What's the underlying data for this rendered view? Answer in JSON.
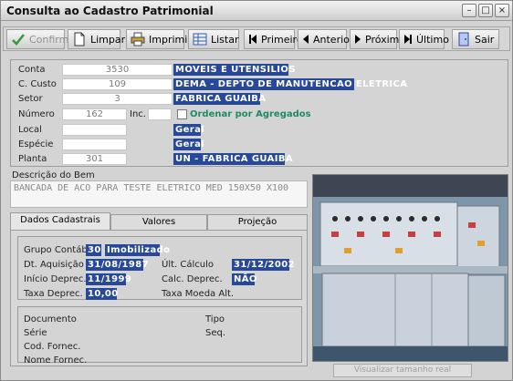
{
  "window": {
    "title": "Consulta ao Cadastro Patrimonial"
  },
  "toolbar": {
    "confirmar": "Confirmar",
    "limpar": "Limpar",
    "imprimir": "Imprimir",
    "listar": "Listar",
    "primeiro": "Primeiro",
    "anterior": "Anterior",
    "proximo": "Próximo",
    "ultimo": "Último",
    "sair": "Sair"
  },
  "form": {
    "conta": {
      "label": "Conta",
      "code": "3530",
      "desc": "MOVEIS E UTENSILIOS"
    },
    "custo": {
      "label": "C. Custo",
      "code": "109",
      "desc": "DEMA - DEPTO DE MANUTENCAO ELETRICA"
    },
    "setor": {
      "label": "Setor",
      "code": "3",
      "desc": "FABRICA GUAIBA"
    },
    "numero": {
      "label": "Número",
      "code": "162",
      "inc_label": "Inc.",
      "inc_value": ""
    },
    "ordenar": {
      "label": "Ordenar por Agregados",
      "checked": false
    },
    "local": {
      "label": "Local",
      "code": "",
      "desc": "Geral"
    },
    "especie": {
      "label": "Espécie",
      "code": "",
      "desc": "Geral"
    },
    "planta": {
      "label": "Planta",
      "code": "301",
      "desc": "UN - FABRICA GUAIBA"
    }
  },
  "descricao": {
    "label": "Descrição do Bem",
    "text": "BANCADA DE ACO PARA TESTE ELETRICO MED 150X50 X100"
  },
  "tabs": [
    "Dados Cadastrais",
    "Valores",
    "Projeção"
  ],
  "dados": {
    "grupo": {
      "label": "Grupo Contábil",
      "code": "30",
      "desc": "Imobilizado"
    },
    "aquisicao": {
      "label": "Dt. Aquisição",
      "value": "31/08/1987"
    },
    "ult_calculo": {
      "label": "Últ. Cálculo",
      "value": "31/12/2002"
    },
    "inicio_deprec": {
      "label": "Início Deprec.",
      "value": "11/1999"
    },
    "calc_deprec": {
      "label": "Calc. Deprec.",
      "value": "NÃO"
    },
    "taxa_deprec": {
      "label": "Taxa Deprec.",
      "value": "10,00"
    },
    "taxa_moeda": {
      "label": "Taxa Moeda Alt.",
      "value": ""
    }
  },
  "documento": {
    "documento": "Documento",
    "tipo": "Tipo",
    "serie": "Série",
    "seq": "Seq.",
    "cod_fornec": "Cod. Fornec.",
    "nome_fornec": "Nome Fornec."
  },
  "photo": {
    "button": "Visualizar tamanho real"
  }
}
